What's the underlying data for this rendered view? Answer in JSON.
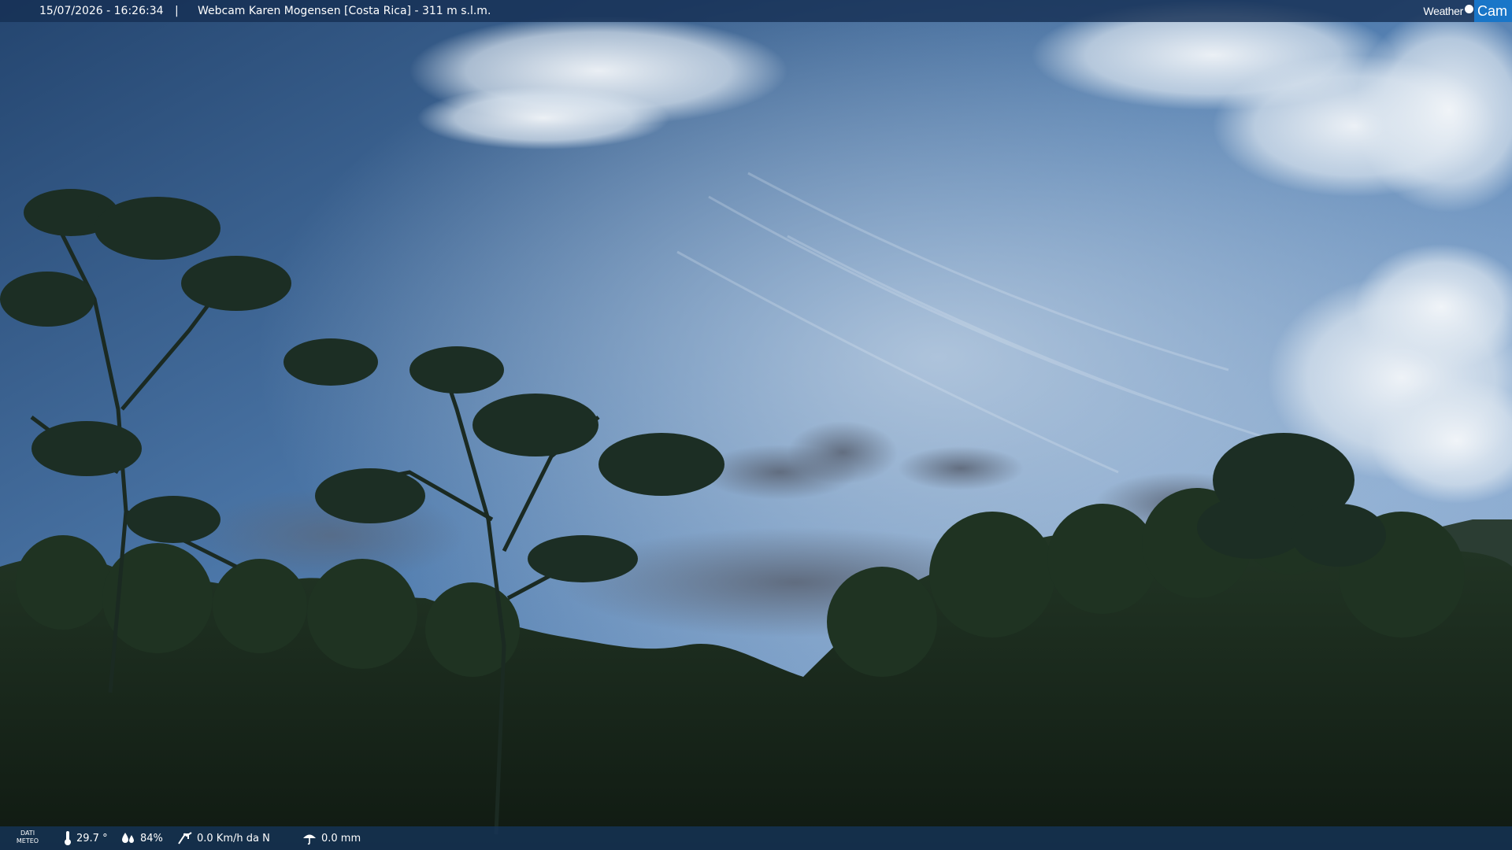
{
  "header": {
    "timestamp": "15/07/2026 - 16:26:34",
    "separator": "|",
    "title": "Webcam Karen Mogensen [Costa Rica]  - 311 m s.l.m."
  },
  "logo": {
    "word": "Weather",
    "cam": "Cam"
  },
  "footer": {
    "label_line1": "DATI",
    "label_line2": "METEO",
    "temperature": "29.7 °",
    "humidity": "84%",
    "wind": "0.0 Km/h da N",
    "rain": "0.0 mm"
  },
  "colors": {
    "bar": "#163054",
    "logo_blue": "#1976c8",
    "sky_top": "#2d4f7c",
    "sky_mid": "#6f99c6",
    "foliage": "#1a2a1c"
  },
  "icons": [
    "thermometer-icon",
    "humidity-drops-icon",
    "wind-icon",
    "rain-icon"
  ]
}
